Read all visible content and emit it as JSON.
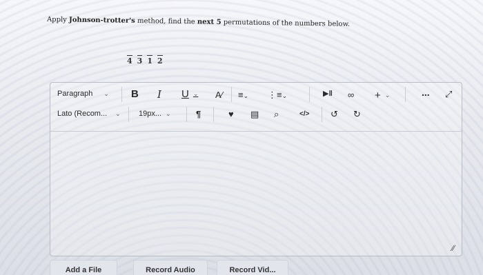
{
  "question": {
    "prefix": "Apply",
    "name": "Johnson-trotter's",
    "middle": "method, find the",
    "next_word": "next 5",
    "suffix": "permutations of the numbers below."
  },
  "permutation": [
    "4",
    "3",
    "1",
    "2"
  ],
  "toolbar": {
    "paragraph_label": "Paragraph",
    "font_label": "Lato (Recom...",
    "size_label": "19px...",
    "bold": "B",
    "italic": "I",
    "underline": "U",
    "plus": "+",
    "more": "..."
  },
  "buttons": {
    "add_file": "Add a File",
    "record_audio": "Record Audio",
    "record_video": "Record Vid..."
  }
}
